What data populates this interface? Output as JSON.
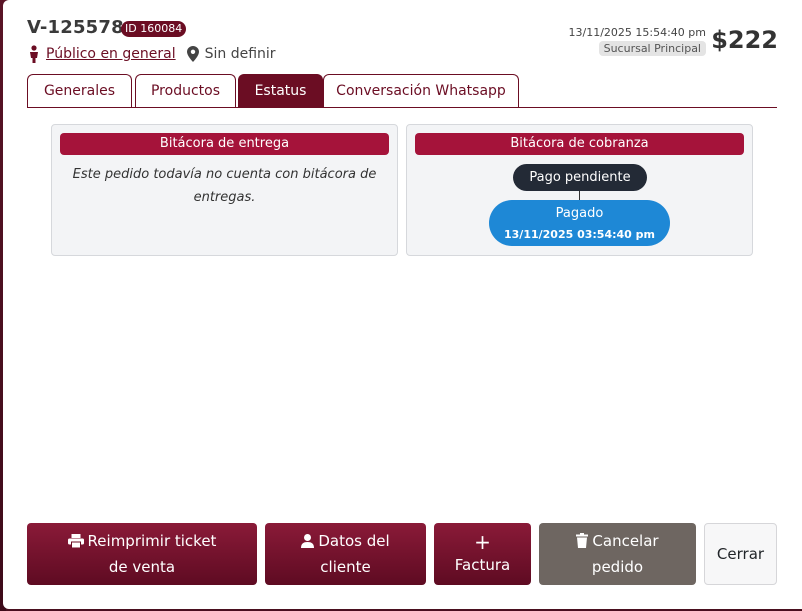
{
  "header": {
    "order_code": "V-125578",
    "id_badge": "ID 160084",
    "client_name": "Público en general",
    "location": "Sin definir",
    "datetime": "13/11/2025 15:54:40 pm",
    "branch": "Sucursal Principal",
    "total": "$222"
  },
  "tabs": [
    {
      "label": "Generales",
      "active": false
    },
    {
      "label": "Productos",
      "active": false
    },
    {
      "label": "Estatus",
      "active": true
    },
    {
      "label": "Conversación Whatsapp",
      "active": false
    }
  ],
  "delivery_log": {
    "title": "Bitácora de entrega",
    "empty_message": "Este pedido todavía no cuenta con bitácora de entregas."
  },
  "billing_log": {
    "title": "Bitácora de cobranza",
    "events": [
      {
        "label": "Pago pendiente"
      },
      {
        "label": "Pagado",
        "date": "13/11/2025 03:54:40 pm"
      }
    ]
  },
  "footer": {
    "reprint_label": "Reimprimir ticket de venta",
    "client_data_label": "Datos del cliente",
    "invoice_icon": "+",
    "invoice_label": "Factura",
    "cancel_label": "Cancelar pedido",
    "close_label": "Cerrar"
  },
  "colors": {
    "brand": "#6b0d23",
    "panel_header": "#a5133a",
    "paid": "#1e88d6",
    "pending": "#232a36"
  }
}
